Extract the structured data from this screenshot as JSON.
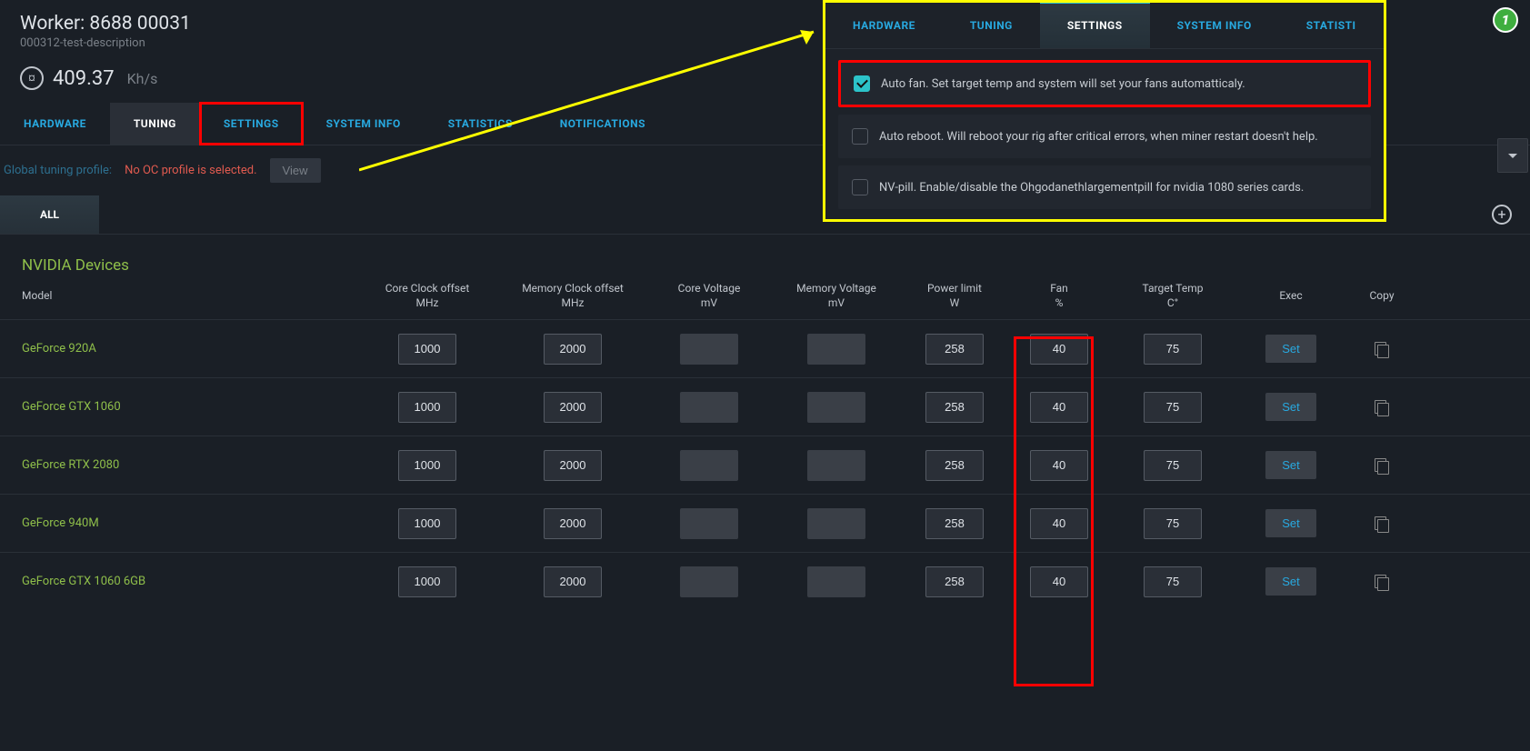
{
  "header": {
    "title": "Worker: 8688 00031",
    "description": "000312-test-description"
  },
  "hashrate": {
    "value": "409.37",
    "unit": "Kh/s"
  },
  "mainTabs": [
    "HARDWARE",
    "TUNING",
    "SETTINGS",
    "SYSTEM INFO",
    "STATISTICS",
    "NOTIFICATIONS"
  ],
  "profile": {
    "label": "Global tuning profile:",
    "warn": "No OC profile is selected.",
    "view": "View"
  },
  "subTab": "ALL",
  "sectionTitle": "NVIDIA Devices",
  "columns": {
    "model": "Model",
    "core": {
      "l1": "Core Clock offset",
      "l2": "MHz"
    },
    "mem": {
      "l1": "Memory Clock offset",
      "l2": "MHz"
    },
    "cvolt": {
      "l1": "Core Voltage",
      "l2": "mV"
    },
    "mvolt": {
      "l1": "Memory Voltage",
      "l2": "mV"
    },
    "power": {
      "l1": "Power limit",
      "l2": "W"
    },
    "fan": {
      "l1": "Fan",
      "l2": "%"
    },
    "temp": {
      "l1": "Target Temp",
      "l2": "C°"
    },
    "exec": "Exec",
    "copy": "Copy"
  },
  "rows": [
    {
      "model": "GeForce 920A",
      "core": "1000",
      "mem": "2000",
      "power": "258",
      "fan": "40",
      "temp": "75"
    },
    {
      "model": "GeForce GTX 1060",
      "core": "1000",
      "mem": "2000",
      "power": "258",
      "fan": "40",
      "temp": "75"
    },
    {
      "model": "GeForce RTX 2080",
      "core": "1000",
      "mem": "2000",
      "power": "258",
      "fan": "40",
      "temp": "75"
    },
    {
      "model": "GeForce 940M",
      "core": "1000",
      "mem": "2000",
      "power": "258",
      "fan": "40",
      "temp": "75"
    },
    {
      "model": "GeForce GTX 1060 6GB",
      "core": "1000",
      "mem": "2000",
      "power": "258",
      "fan": "40",
      "temp": "75"
    }
  ],
  "setLabel": "Set",
  "overlay": {
    "tabs": [
      "HARDWARE",
      "TUNING",
      "SETTINGS",
      "SYSTEM INFO",
      "STATISTI"
    ],
    "rows": [
      {
        "checked": true,
        "text": "Auto fan. Set target temp and system will set your fans automatticaly."
      },
      {
        "checked": false,
        "text": "Auto reboot. Will reboot your rig after critical errors, when miner restart doesn't help."
      },
      {
        "checked": false,
        "text": "NV-pill. Enable/disable the Ohgodanethlargementpill for nvidia 1080 series cards."
      }
    ]
  },
  "stepBadge": "1"
}
